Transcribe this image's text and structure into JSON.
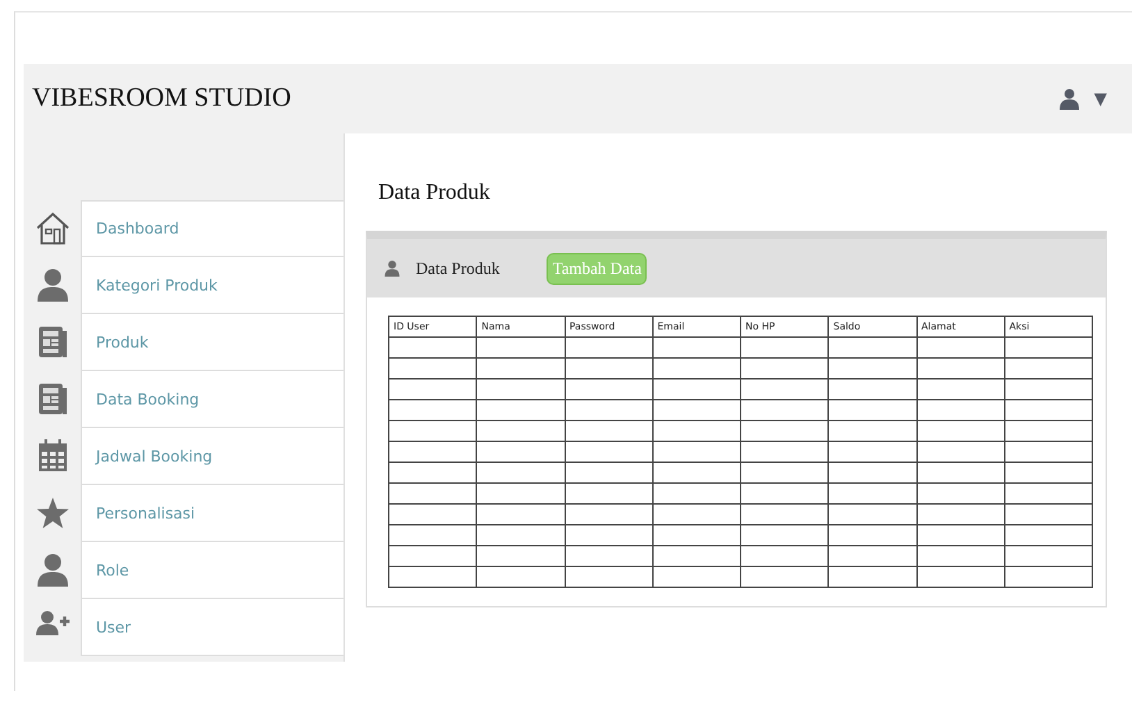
{
  "header": {
    "title": "VIBESROOM STUDIO",
    "user_menu": "▼"
  },
  "sidebar": {
    "items": [
      {
        "label": "Dashboard"
      },
      {
        "label": "Kategori Produk"
      },
      {
        "label": "Produk"
      },
      {
        "label": "Data Booking"
      },
      {
        "label": "Jadwal Booking"
      },
      {
        "label": "Personalisasi"
      },
      {
        "label": "Role"
      },
      {
        "label": "User"
      }
    ]
  },
  "page_title": "Data Produk",
  "panel": {
    "title": "Data Produk",
    "add_button": "Tambah Data"
  },
  "table": {
    "columns": [
      "ID User",
      "Nama",
      "Password",
      "Email",
      "No HP",
      "Saldo",
      "Alamat",
      "Aksi"
    ]
  }
}
